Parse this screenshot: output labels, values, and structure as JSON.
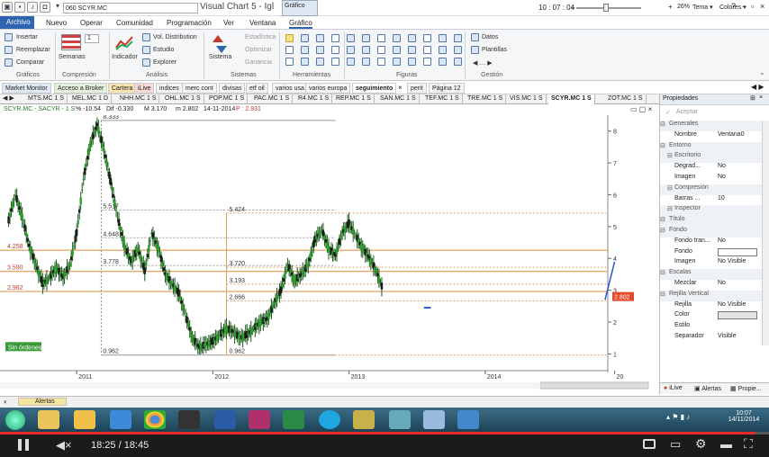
{
  "app": {
    "symbol_box": "060 SCYR.MC",
    "title": "Visual Chart 5 - Igl",
    "context_tab": "Gráfico",
    "clock": "10 : 07 : 04",
    "zoom": "26%",
    "tema": "Tema",
    "colores": "Colores"
  },
  "menu": [
    "Archivo",
    "Nuevo",
    "Operar",
    "Comunidad",
    "Programación",
    "Ver",
    "Ventana",
    "Gráfico"
  ],
  "ribbon": {
    "graficos": {
      "insertar": "Insertar",
      "reemplazar": "Reemplazar",
      "comparar": "Comparar",
      "group": "Gráficos"
    },
    "compresion": {
      "semanas": "Semanas",
      "value": "1",
      "group": "Compresión"
    },
    "analisis": {
      "indicador": "Indicador",
      "vol_distribution": "Vol. Distribution",
      "estudio": "Estudio",
      "explorer": "Explorer",
      "group": "Análisis"
    },
    "sistemas": {
      "sistema": "Sistema",
      "estadistica": "Estadística",
      "optimizar": "Optimizar",
      "ganancia": "Ganancia",
      "group": "Sistemas"
    },
    "herramientas": {
      "group": "Herramientas"
    },
    "figuras": {
      "group": "Figuras"
    },
    "gestion": {
      "datos": "Datos",
      "plantillas": "Plantillas",
      "group": "Gestión"
    }
  },
  "tabs_top": [
    "Market Monitor",
    "Acceso a Broker",
    "Cartera",
    "iLive",
    "indices",
    "merc cont",
    "divisas",
    "etf oil",
    "varios usa",
    "varios europa",
    "seguimiento",
    "perit",
    "Página 12"
  ],
  "tabs_symbols": [
    "MTS.MC 1 S",
    "MEL.MC 1 D",
    "NHH.MC 1 S",
    "OHL.MC 1 S",
    "POP.MC 1 S",
    "PAC.MC 1 S",
    "R4.MC 1 S",
    "REP.MC 1 S",
    "SAN.MC 1 S",
    "TEF.MC 1 S",
    "TRE.MC 1 S",
    "VIS.MC 1 S",
    "SCYR.MC 1 S",
    "ZOT.MC 1 S"
  ],
  "chart_info": {
    "name": "SCYR.MC - SACYR - 1 S",
    "dif_label": "Dif",
    "dif_pct": "% -10.54",
    "dif": "Dif -0.330",
    "m": "M 3.170",
    "m2": "m 2.802",
    "date": "14-11-2014",
    "p": "P : 2.931"
  },
  "chart_data": {
    "type": "candlestick",
    "x_ticks": [
      "2011",
      "2012",
      "2013",
      "2014",
      "20"
    ],
    "y_ticks": [
      "8",
      "7",
      "6",
      "5",
      "4",
      "3",
      "2",
      "1"
    ],
    "ylim": [
      0.7,
      8.5
    ],
    "current_price_label": "2.802",
    "h_levels": [
      {
        "value": 4.258,
        "label": "4.258"
      },
      {
        "value": 3.59,
        "label": "3.590"
      },
      {
        "value": 2.962,
        "label": "2.962"
      }
    ],
    "fib_left": [
      "8.333",
      "5.517",
      "4.648",
      "3.778",
      "0.962"
    ],
    "fib_right": [
      "5.424",
      "3.720",
      "3.193",
      "2.666",
      "0.962"
    ],
    "sin_ordenes": "Sin órdenes",
    "series": [
      {
        "name": "SCYR.MC",
        "points": [
          [
            2010.5,
            5.2
          ],
          [
            2010.55,
            6.0
          ],
          [
            2010.6,
            5.3
          ],
          [
            2010.65,
            4.4
          ],
          [
            2010.7,
            3.8
          ],
          [
            2010.75,
            3.2
          ],
          [
            2010.8,
            3.4
          ],
          [
            2010.85,
            3.7
          ],
          [
            2010.9,
            3.4
          ],
          [
            2010.95,
            3.8
          ],
          [
            2011.0,
            4.8
          ],
          [
            2011.05,
            6.5
          ],
          [
            2011.1,
            7.6
          ],
          [
            2011.15,
            8.2
          ],
          [
            2011.2,
            7.4
          ],
          [
            2011.25,
            6.4
          ],
          [
            2011.3,
            5.3
          ],
          [
            2011.35,
            4.4
          ],
          [
            2011.4,
            3.9
          ],
          [
            2011.45,
            4.3
          ],
          [
            2011.5,
            3.6
          ],
          [
            2011.55,
            4.8
          ],
          [
            2011.6,
            4.3
          ],
          [
            2011.65,
            3.5
          ],
          [
            2011.7,
            3.2
          ],
          [
            2011.75,
            2.9
          ],
          [
            2011.8,
            2.2
          ],
          [
            2011.85,
            1.5
          ],
          [
            2011.9,
            1.2
          ],
          [
            2011.95,
            1.3
          ],
          [
            2012.0,
            1.4
          ],
          [
            2012.05,
            1.6
          ],
          [
            2012.1,
            1.8
          ],
          [
            2012.15,
            1.7
          ],
          [
            2012.2,
            1.5
          ],
          [
            2012.25,
            1.6
          ],
          [
            2012.3,
            1.8
          ],
          [
            2012.35,
            2.0
          ],
          [
            2012.4,
            2.1
          ],
          [
            2012.45,
            2.6
          ],
          [
            2012.5,
            3.0
          ],
          [
            2012.55,
            3.8
          ],
          [
            2012.6,
            3.3
          ],
          [
            2012.65,
            3.5
          ],
          [
            2012.7,
            3.8
          ],
          [
            2012.75,
            4.6
          ],
          [
            2012.8,
            4.9
          ],
          [
            2012.85,
            4.3
          ],
          [
            2012.9,
            4.1
          ],
          [
            2012.95,
            4.8
          ],
          [
            2013.0,
            5.1
          ],
          [
            2013.05,
            4.7
          ],
          [
            2013.1,
            4.3
          ],
          [
            2013.15,
            4.0
          ],
          [
            2013.2,
            3.6
          ],
          [
            2013.25,
            3.0
          ]
        ]
      }
    ]
  },
  "right_panel": {
    "title": "Propiedades",
    "aceptar": "Aceptar",
    "rows": [
      {
        "k": "Generales",
        "grp": true
      },
      {
        "k": "Nombre",
        "v": "Ventana0"
      },
      {
        "k": "Entorno",
        "grp": true
      },
      {
        "k": "Escritorio",
        "grp": true,
        "sub": true
      },
      {
        "k": "Degrad...",
        "v": "No"
      },
      {
        "k": "Imagen",
        "v": "No"
      },
      {
        "k": "Compresión",
        "grp": true,
        "sub": true
      },
      {
        "k": "Barras ...",
        "v": "10"
      },
      {
        "k": "Inspector",
        "grp": true,
        "sub": true
      },
      {
        "k": "Título",
        "grp": true
      },
      {
        "k": "Fondo",
        "grp": true
      },
      {
        "k": "Fondo tran...",
        "v": "No"
      },
      {
        "k": "Fondo",
        "v": ""
      },
      {
        "k": "Imagen",
        "v": "No Visible"
      },
      {
        "k": "Escalas",
        "grp": true
      },
      {
        "k": "Mezclar",
        "v": "No"
      },
      {
        "k": "Rejilla Vertical",
        "grp": true
      },
      {
        "k": "Rejilla",
        "v": "No Visible"
      },
      {
        "k": "Color",
        "v": ""
      },
      {
        "k": "Estilo",
        "v": ""
      },
      {
        "k": "Separador",
        "v": "Visible"
      }
    ],
    "footer": [
      "iLive",
      "Alertas",
      "Propie..."
    ]
  },
  "status": {
    "alertas": "Alertas"
  },
  "taskbar": {
    "time": "10:07",
    "date": "14/11/2014"
  },
  "player": {
    "time": "18:25 / 18:45"
  }
}
